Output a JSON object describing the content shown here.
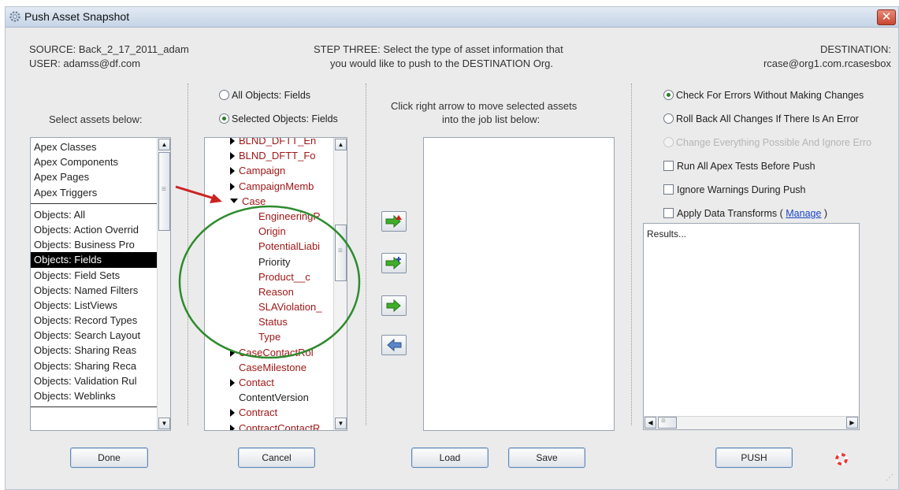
{
  "window": {
    "title": "Push Asset Snapshot",
    "close_glyph": "✕"
  },
  "header": {
    "source": "SOURCE: Back_2_17_2011_adam",
    "user": "USER: adamss@df.com",
    "step_line1": "STEP THREE: Select the type of asset information that",
    "step_line2": "you would like to push to the DESTINATION Org.",
    "destination_label": "DESTINATION:",
    "destination_value": "rcase@org1.com.rcasesbox"
  },
  "assets": {
    "prompt": "Select assets below:",
    "items": [
      "Apex Classes",
      "Apex Components",
      "Apex Pages",
      "Apex Triggers",
      "Objects: All",
      "Objects: Action Overrid",
      "Objects: Business Pro",
      "Objects: Fields",
      "Objects: Field Sets",
      "Objects: Named Filters",
      "Objects: ListViews",
      "Objects: Record Types",
      "Objects: Search Layout",
      "Objects: Sharing Reas",
      "Objects: Sharing Reca",
      "Objects: Validation Rul",
      "Objects: Weblinks"
    ],
    "selected": "Objects: Fields"
  },
  "fields_panel": {
    "option_all": "All Objects: Fields",
    "option_selected": "Selected Objects: Fields",
    "tree": [
      "BLND_DFTT_En",
      "BLND_DFTT_Fo",
      "Campaign",
      "CampaignMemb",
      "Case",
      "EngineeringR",
      "Origin",
      "PotentialLiabi",
      "Priority",
      "Product__c",
      "Reason",
      "SLAViolation_",
      "Status",
      "Type",
      "CaseContactRol",
      "CaseMilestone",
      "Contact",
      "ContentVersion",
      "Contract",
      "ContractContactR"
    ]
  },
  "job_panel": {
    "instructions_line1": "Click right arrow to move selected assets",
    "instructions_line2": "into the job list below:"
  },
  "options": {
    "check_errors": "Check For Errors Without Making Changes",
    "roll_back": "Roll Back All Changes If There Is An Error",
    "change_everything": "Change Everything Possible And Ignore Erro",
    "run_tests": "Run All Apex Tests Before Push",
    "ignore_warnings": "Ignore Warnings During Push",
    "apply_transforms_prefix": "Apply Data Transforms (",
    "manage_link": "Manage",
    "apply_transforms_suffix": ")",
    "results_text": "Results..."
  },
  "buttons": {
    "done": "Done",
    "cancel": "Cancel",
    "load": "Load",
    "save": "Save",
    "push": "PUSH"
  },
  "colors": {
    "field_red": "#a01818",
    "annotation_green": "#2e8b2e",
    "annotation_arrow": "#cc2222",
    "arrow_button_green": "#3fae2a"
  },
  "icons": {
    "title": "gear-icon",
    "close": "close-icon",
    "help": "lifebuoy-icon"
  }
}
